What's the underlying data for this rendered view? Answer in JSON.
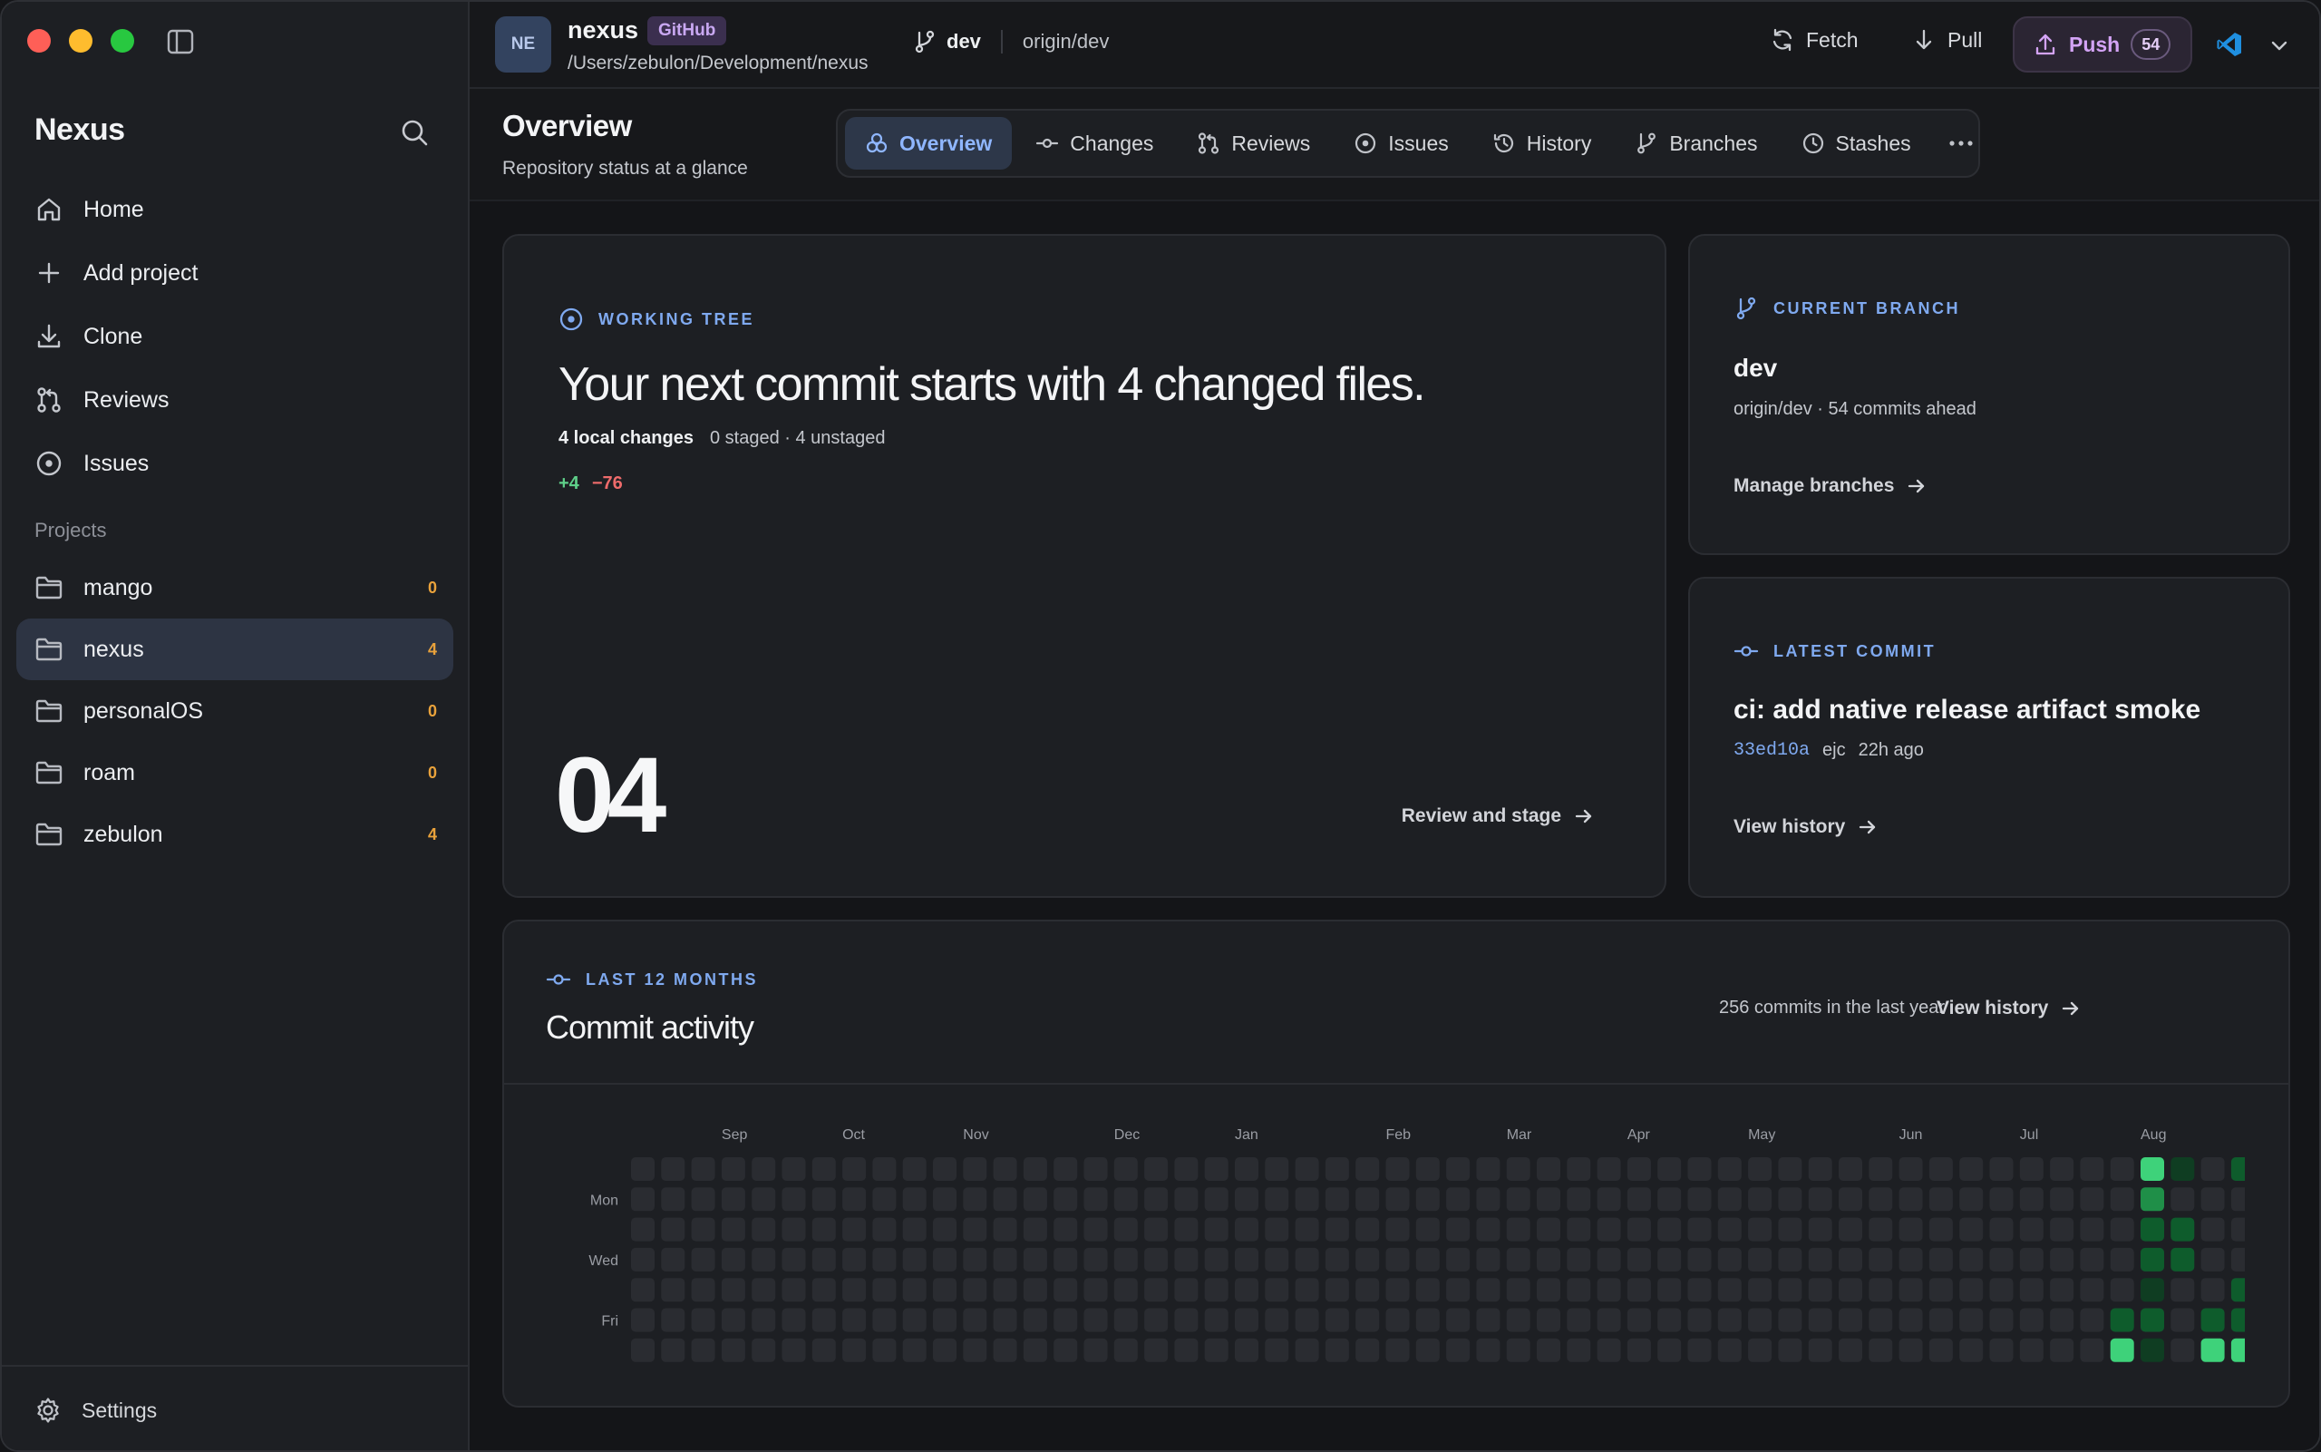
{
  "sidebar": {
    "brand": "Nexus",
    "nav": [
      {
        "label": "Home",
        "icon": "home-icon"
      },
      {
        "label": "Add project",
        "icon": "plus-icon"
      },
      {
        "label": "Clone",
        "icon": "download-icon"
      },
      {
        "label": "Reviews",
        "icon": "pull-request-icon"
      },
      {
        "label": "Issues",
        "icon": "issue-icon"
      }
    ],
    "projects_label": "Projects",
    "projects": [
      {
        "name": "mango",
        "count": "0",
        "active": false
      },
      {
        "name": "nexus",
        "count": "4",
        "active": true
      },
      {
        "name": "personalOS",
        "count": "0",
        "active": false
      },
      {
        "name": "roam",
        "count": "0",
        "active": false
      },
      {
        "name": "zebulon",
        "count": "4",
        "active": false
      }
    ],
    "settings_label": "Settings"
  },
  "topbar": {
    "avatar": "NE",
    "repo_name": "nexus",
    "badge": "GitHub",
    "path": "/Users/zebulon/Development/nexus",
    "branch": "dev",
    "remote": "origin/dev",
    "fetch": "Fetch",
    "pull": "Pull",
    "push": "Push",
    "push_count": "54"
  },
  "page": {
    "title": "Overview",
    "subtitle": "Repository status at a glance",
    "tabs": [
      {
        "label": "Overview",
        "icon": "overview-icon",
        "active": true
      },
      {
        "label": "Changes",
        "icon": "commit-icon",
        "active": false
      },
      {
        "label": "Reviews",
        "icon": "pull-request-icon",
        "active": false
      },
      {
        "label": "Issues",
        "icon": "issue-icon",
        "active": false
      },
      {
        "label": "History",
        "icon": "history-icon",
        "active": false
      },
      {
        "label": "Branches",
        "icon": "branch-icon",
        "active": false
      },
      {
        "label": "Stashes",
        "icon": "clock-icon",
        "active": false
      }
    ]
  },
  "working_tree": {
    "kicker": "WORKING TREE",
    "headline": "Your next commit starts with 4 changed files.",
    "local_changes": "4 local changes",
    "staged_info": "0 staged · 4 unstaged",
    "additions": "+4",
    "deletions": "−76",
    "big_number": "04",
    "action": "Review and stage"
  },
  "current_branch": {
    "kicker": "CURRENT BRANCH",
    "name": "dev",
    "meta": "origin/dev · 54 commits ahead",
    "action": "Manage branches"
  },
  "latest_commit": {
    "kicker": "LATEST COMMIT",
    "message": "ci: add native release artifact smoke",
    "sha": "33ed10a",
    "author": "ejc",
    "time": "22h ago",
    "action": "View history"
  },
  "activity": {
    "kicker": "LAST 12 MONTHS",
    "title": "Commit activity",
    "summary": "256 commits in the last year",
    "action": "View history",
    "months": [
      {
        "label": "Sep",
        "week": 3
      },
      {
        "label": "Oct",
        "week": 7
      },
      {
        "label": "Nov",
        "week": 11
      },
      {
        "label": "Dec",
        "week": 16
      },
      {
        "label": "Jan",
        "week": 20
      },
      {
        "label": "Feb",
        "week": 25
      },
      {
        "label": "Mar",
        "week": 29
      },
      {
        "label": "Apr",
        "week": 33
      },
      {
        "label": "May",
        "week": 37
      },
      {
        "label": "Jun",
        "week": 42
      },
      {
        "label": "Jul",
        "week": 46
      },
      {
        "label": "Aug",
        "week": 50
      }
    ],
    "day_labels": [
      {
        "label": "Mon",
        "day": 1
      },
      {
        "label": "Wed",
        "day": 3
      },
      {
        "label": "Fri",
        "day": 5
      }
    ],
    "weeks": 54,
    "levels": [
      {
        "week": 49,
        "day": 6,
        "level": 4
      },
      {
        "week": 49,
        "day": 5,
        "level": 2
      },
      {
        "week": 50,
        "day": 0,
        "level": 4
      },
      {
        "week": 50,
        "day": 1,
        "level": 3
      },
      {
        "week": 50,
        "day": 2,
        "level": 2
      },
      {
        "week": 50,
        "day": 3,
        "level": 2
      },
      {
        "week": 50,
        "day": 4,
        "level": 1
      },
      {
        "week": 50,
        "day": 5,
        "level": 2
      },
      {
        "week": 50,
        "day": 6,
        "level": 1
      },
      {
        "week": 51,
        "day": 0,
        "level": 1
      },
      {
        "week": 51,
        "day": 2,
        "level": 2
      },
      {
        "week": 51,
        "day": 3,
        "level": 2
      },
      {
        "week": 52,
        "day": 5,
        "level": 2
      },
      {
        "week": 52,
        "day": 6,
        "level": 4
      },
      {
        "week": 53,
        "day": 0,
        "level": 2
      },
      {
        "week": 53,
        "day": 4,
        "level": 2
      },
      {
        "week": 53,
        "day": 5,
        "level": 2
      },
      {
        "week": 53,
        "day": 6,
        "level": 4
      }
    ],
    "colors": {
      "empty": "#2a2c31",
      "l1": "#0f3d22",
      "l2": "#0e5c2c",
      "l3": "#1f8f48",
      "l4": "#3ed27a"
    }
  }
}
